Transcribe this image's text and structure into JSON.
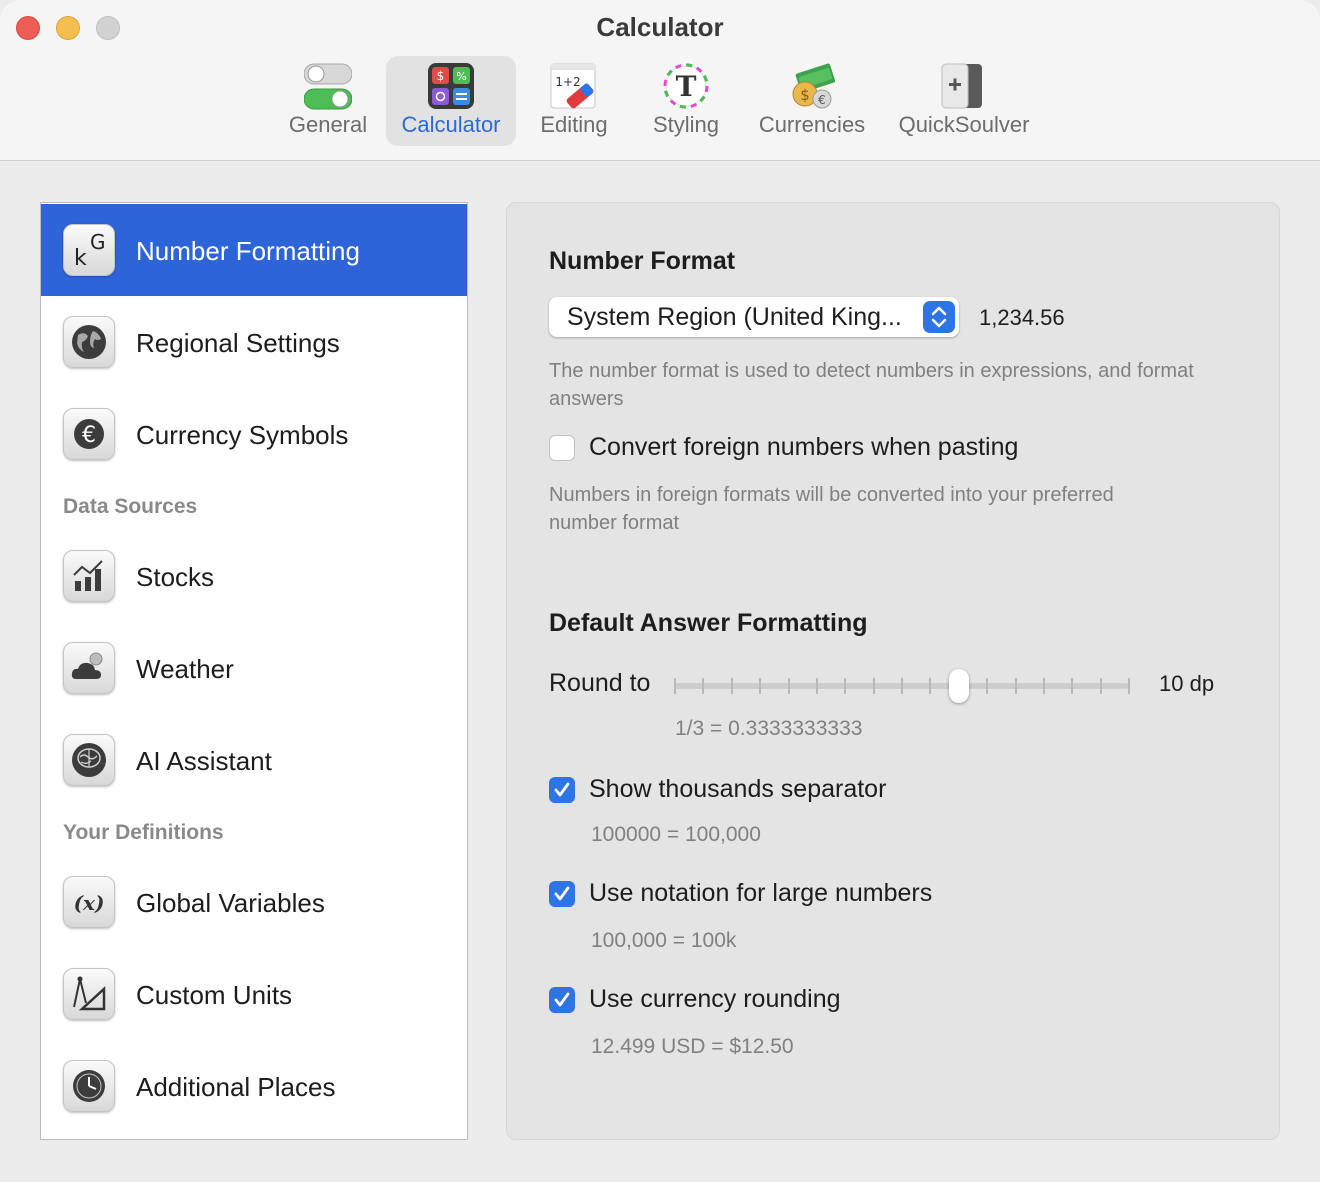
{
  "window": {
    "title": "Calculator"
  },
  "toolbar": {
    "tabs": [
      {
        "label": "General",
        "icon": "toggle-switches-icon"
      },
      {
        "label": "Calculator",
        "icon": "calculator-icon",
        "active": true
      },
      {
        "label": "Editing",
        "icon": "eraser-icon"
      },
      {
        "label": "Styling",
        "icon": "font-style-icon"
      },
      {
        "label": "Currencies",
        "icon": "money-icon"
      },
      {
        "label": "QuickSoulver",
        "icon": "quicksoulver-icon"
      }
    ]
  },
  "sidebar": {
    "items": [
      {
        "label": "Number Formatting",
        "icon": "number-formatting-icon",
        "selected": true
      },
      {
        "label": "Regional Settings",
        "icon": "globe-icon"
      },
      {
        "label": "Currency Symbols",
        "icon": "euro-icon"
      }
    ],
    "sections": [
      {
        "title": "Data Sources",
        "items": [
          {
            "label": "Stocks",
            "icon": "stocks-chart-icon"
          },
          {
            "label": "Weather",
            "icon": "weather-cloud-icon"
          },
          {
            "label": "AI Assistant",
            "icon": "brain-icon"
          }
        ]
      },
      {
        "title": "Your Definitions",
        "items": [
          {
            "label": "Global Variables",
            "icon": "variable-icon"
          },
          {
            "label": "Custom Units",
            "icon": "compass-ruler-icon"
          },
          {
            "label": "Additional Places",
            "icon": "clock-icon"
          }
        ]
      }
    ]
  },
  "number_format": {
    "heading": "Number Format",
    "selected": "System Region (United King...",
    "sample": "1,234.56",
    "help": "The number format is used to detect numbers in expressions, and format answers",
    "convert_label": "Convert foreign numbers when pasting",
    "convert_checked": false,
    "convert_help": "Numbers in foreign formats will be converted into your preferred number format"
  },
  "answer_formatting": {
    "heading": "Default Answer Formatting",
    "round_label": "Round to",
    "round_value": "10 dp",
    "round_level": 10,
    "round_max": 16,
    "round_example": "1/3 = 0.3333333333",
    "options": [
      {
        "label": "Show thousands separator",
        "checked": true,
        "example": "100000 = 100,000"
      },
      {
        "label": "Use notation for large numbers",
        "checked": true,
        "example": "100,000 = 100k"
      },
      {
        "label": "Use currency rounding",
        "checked": true,
        "example": "12.499 USD = $12.50"
      }
    ]
  },
  "colors": {
    "accent": "#2d64d8",
    "checkbox": "#2d74e6",
    "close": "#ee5e56",
    "minimize": "#f5bf4f",
    "zoom": "#d1d1d1"
  }
}
